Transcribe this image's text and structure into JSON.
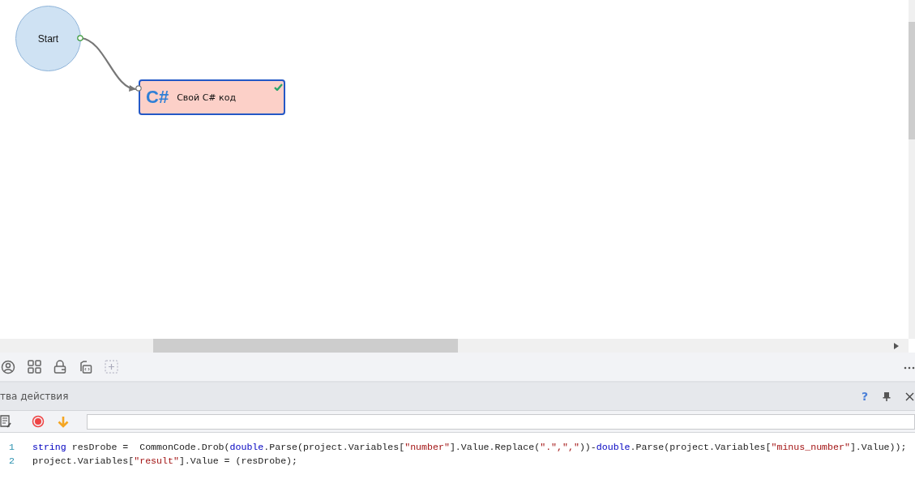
{
  "canvas": {
    "nodes": [
      {
        "kind": "start",
        "label": "Start"
      },
      {
        "kind": "action",
        "icon_text": "C#",
        "label": "Свой C# код",
        "valid": true,
        "selected": true
      }
    ]
  },
  "panel": {
    "title": "тва действия",
    "help_button": "?"
  },
  "code_lines": [
    {
      "number": "1",
      "tokens": [
        {
          "kind": "keyword",
          "text": "string"
        },
        {
          "kind": "plain",
          "text": " resDrobe =  CommonCode.Drob("
        },
        {
          "kind": "keyword",
          "text": "double"
        },
        {
          "kind": "plain",
          "text": ".Parse(project.Variables["
        },
        {
          "kind": "string",
          "text": "\"number\""
        },
        {
          "kind": "plain",
          "text": "].Value.Replace("
        },
        {
          "kind": "string",
          "text": "\".\",\",\""
        },
        {
          "kind": "plain",
          "text": "))-"
        },
        {
          "kind": "keyword",
          "text": "double"
        },
        {
          "kind": "plain",
          "text": ".Parse(project.Variables["
        },
        {
          "kind": "string",
          "text": "\"minus_number\""
        },
        {
          "kind": "plain",
          "text": "].Value));"
        }
      ]
    },
    {
      "number": "2",
      "tokens": [
        {
          "kind": "plain",
          "text": "project.Variables["
        },
        {
          "kind": "string",
          "text": "\"result\""
        },
        {
          "kind": "plain",
          "text": "].Value = (resDrobe);"
        }
      ]
    }
  ]
}
